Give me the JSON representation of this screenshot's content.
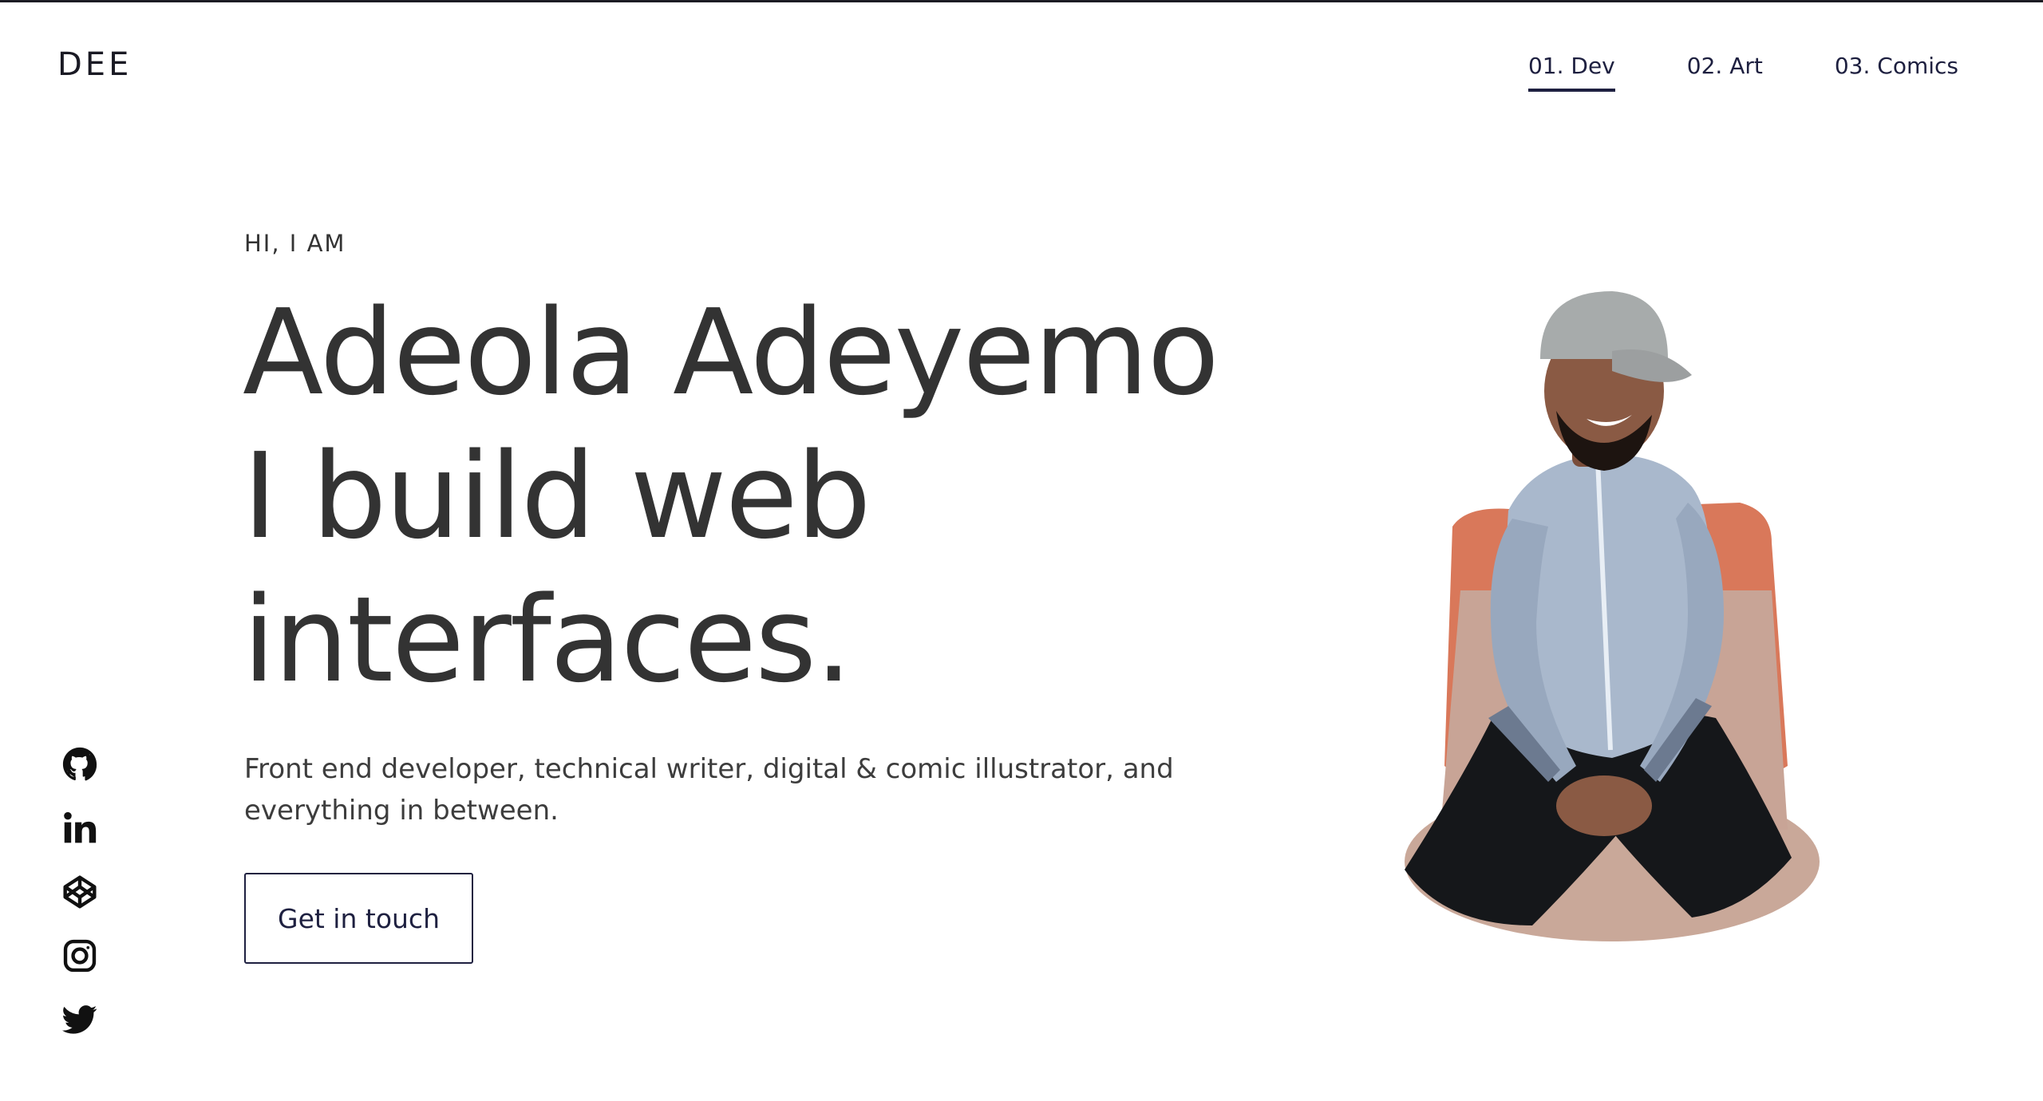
{
  "header": {
    "logo": "DEE",
    "nav": [
      {
        "label": "01. Dev",
        "active": true
      },
      {
        "label": "02. Art",
        "active": false
      },
      {
        "label": "03. Comics",
        "active": false
      }
    ]
  },
  "hero": {
    "eyebrow": "HI, I AM",
    "headline_lines": [
      "Adeola Adeyemo",
      "I build web",
      "interfaces."
    ],
    "intro": "Front end developer, technical writer, digital & comic illustrator, and everything in between.",
    "cta_label": "Get in touch"
  },
  "socials": [
    {
      "icon": "github-icon"
    },
    {
      "icon": "linkedin-icon"
    },
    {
      "icon": "codepen-icon"
    },
    {
      "icon": "instagram-icon"
    },
    {
      "icon": "twitter-icon"
    }
  ],
  "colors": {
    "text": "#333333",
    "accent": "#1e2040",
    "chair": "#d9785a",
    "shirt": "#a9b8cc",
    "cap": "#a7abab",
    "skin": "#8a5a44",
    "pants": "#15171a"
  }
}
